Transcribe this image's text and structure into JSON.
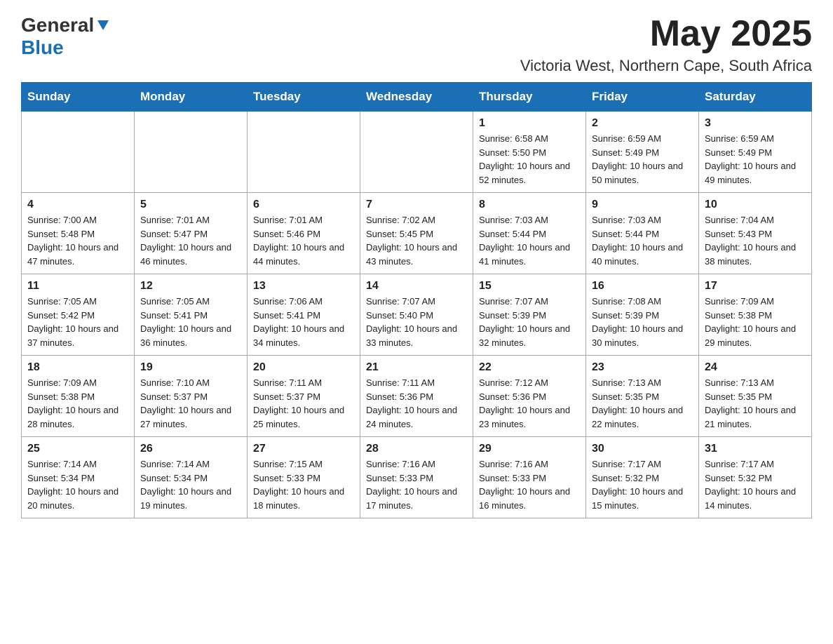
{
  "header": {
    "logo_general": "General",
    "logo_blue": "Blue",
    "month_year": "May 2025",
    "location": "Victoria West, Northern Cape, South Africa"
  },
  "days_of_week": [
    "Sunday",
    "Monday",
    "Tuesday",
    "Wednesday",
    "Thursday",
    "Friday",
    "Saturday"
  ],
  "weeks": [
    [
      {
        "day": "",
        "info": ""
      },
      {
        "day": "",
        "info": ""
      },
      {
        "day": "",
        "info": ""
      },
      {
        "day": "",
        "info": ""
      },
      {
        "day": "1",
        "info": "Sunrise: 6:58 AM\nSunset: 5:50 PM\nDaylight: 10 hours and 52 minutes."
      },
      {
        "day": "2",
        "info": "Sunrise: 6:59 AM\nSunset: 5:49 PM\nDaylight: 10 hours and 50 minutes."
      },
      {
        "day": "3",
        "info": "Sunrise: 6:59 AM\nSunset: 5:49 PM\nDaylight: 10 hours and 49 minutes."
      }
    ],
    [
      {
        "day": "4",
        "info": "Sunrise: 7:00 AM\nSunset: 5:48 PM\nDaylight: 10 hours and 47 minutes."
      },
      {
        "day": "5",
        "info": "Sunrise: 7:01 AM\nSunset: 5:47 PM\nDaylight: 10 hours and 46 minutes."
      },
      {
        "day": "6",
        "info": "Sunrise: 7:01 AM\nSunset: 5:46 PM\nDaylight: 10 hours and 44 minutes."
      },
      {
        "day": "7",
        "info": "Sunrise: 7:02 AM\nSunset: 5:45 PM\nDaylight: 10 hours and 43 minutes."
      },
      {
        "day": "8",
        "info": "Sunrise: 7:03 AM\nSunset: 5:44 PM\nDaylight: 10 hours and 41 minutes."
      },
      {
        "day": "9",
        "info": "Sunrise: 7:03 AM\nSunset: 5:44 PM\nDaylight: 10 hours and 40 minutes."
      },
      {
        "day": "10",
        "info": "Sunrise: 7:04 AM\nSunset: 5:43 PM\nDaylight: 10 hours and 38 minutes."
      }
    ],
    [
      {
        "day": "11",
        "info": "Sunrise: 7:05 AM\nSunset: 5:42 PM\nDaylight: 10 hours and 37 minutes."
      },
      {
        "day": "12",
        "info": "Sunrise: 7:05 AM\nSunset: 5:41 PM\nDaylight: 10 hours and 36 minutes."
      },
      {
        "day": "13",
        "info": "Sunrise: 7:06 AM\nSunset: 5:41 PM\nDaylight: 10 hours and 34 minutes."
      },
      {
        "day": "14",
        "info": "Sunrise: 7:07 AM\nSunset: 5:40 PM\nDaylight: 10 hours and 33 minutes."
      },
      {
        "day": "15",
        "info": "Sunrise: 7:07 AM\nSunset: 5:39 PM\nDaylight: 10 hours and 32 minutes."
      },
      {
        "day": "16",
        "info": "Sunrise: 7:08 AM\nSunset: 5:39 PM\nDaylight: 10 hours and 30 minutes."
      },
      {
        "day": "17",
        "info": "Sunrise: 7:09 AM\nSunset: 5:38 PM\nDaylight: 10 hours and 29 minutes."
      }
    ],
    [
      {
        "day": "18",
        "info": "Sunrise: 7:09 AM\nSunset: 5:38 PM\nDaylight: 10 hours and 28 minutes."
      },
      {
        "day": "19",
        "info": "Sunrise: 7:10 AM\nSunset: 5:37 PM\nDaylight: 10 hours and 27 minutes."
      },
      {
        "day": "20",
        "info": "Sunrise: 7:11 AM\nSunset: 5:37 PM\nDaylight: 10 hours and 25 minutes."
      },
      {
        "day": "21",
        "info": "Sunrise: 7:11 AM\nSunset: 5:36 PM\nDaylight: 10 hours and 24 minutes."
      },
      {
        "day": "22",
        "info": "Sunrise: 7:12 AM\nSunset: 5:36 PM\nDaylight: 10 hours and 23 minutes."
      },
      {
        "day": "23",
        "info": "Sunrise: 7:13 AM\nSunset: 5:35 PM\nDaylight: 10 hours and 22 minutes."
      },
      {
        "day": "24",
        "info": "Sunrise: 7:13 AM\nSunset: 5:35 PM\nDaylight: 10 hours and 21 minutes."
      }
    ],
    [
      {
        "day": "25",
        "info": "Sunrise: 7:14 AM\nSunset: 5:34 PM\nDaylight: 10 hours and 20 minutes."
      },
      {
        "day": "26",
        "info": "Sunrise: 7:14 AM\nSunset: 5:34 PM\nDaylight: 10 hours and 19 minutes."
      },
      {
        "day": "27",
        "info": "Sunrise: 7:15 AM\nSunset: 5:33 PM\nDaylight: 10 hours and 18 minutes."
      },
      {
        "day": "28",
        "info": "Sunrise: 7:16 AM\nSunset: 5:33 PM\nDaylight: 10 hours and 17 minutes."
      },
      {
        "day": "29",
        "info": "Sunrise: 7:16 AM\nSunset: 5:33 PM\nDaylight: 10 hours and 16 minutes."
      },
      {
        "day": "30",
        "info": "Sunrise: 7:17 AM\nSunset: 5:32 PM\nDaylight: 10 hours and 15 minutes."
      },
      {
        "day": "31",
        "info": "Sunrise: 7:17 AM\nSunset: 5:32 PM\nDaylight: 10 hours and 14 minutes."
      }
    ]
  ]
}
